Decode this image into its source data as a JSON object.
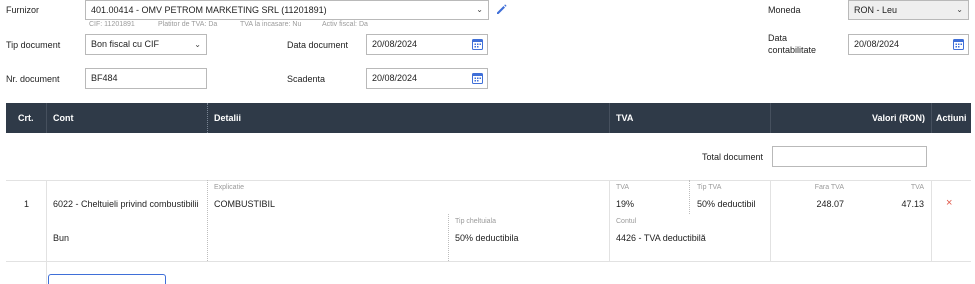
{
  "header": {
    "furnizor_label": "Furnizor",
    "furnizor_value": "401.00414 - OMV PETROM MARKETING SRL (11201891)",
    "meta": {
      "cif": "CIF: 11201891",
      "tva_payer": "Platitor de TVA: Da",
      "tva_incasare": "TVA la incasare: Nu",
      "activ_fiscal": "Activ fiscal: Da"
    },
    "moneda_label": "Moneda",
    "moneda_value": "RON - Leu",
    "tip_document_label": "Tip document",
    "tip_document_value": "Bon fiscal cu CIF",
    "data_document_label": "Data document",
    "data_document_value": "20/08/2024",
    "data_contabilitate_label_1": "Data",
    "data_contabilitate_label_2": "contabilitate",
    "data_contabilitate_value": "20/08/2024",
    "nr_document_label": "Nr. document",
    "nr_document_value": "BF484",
    "scadenta_label": "Scadenta",
    "scadenta_value": "20/08/2024"
  },
  "table": {
    "columns": {
      "crt": "Crt.",
      "cont": "Cont",
      "detalii": "Detalii",
      "tva": "TVA",
      "valori": "Valori (RON)",
      "actiuni": "Actiuni"
    },
    "total_label": "Total document",
    "total_value": "",
    "rows": [
      {
        "crt": "1",
        "cont": "6022 - Cheltuieli privind combustibilii",
        "explicatie_label": "Explicatie",
        "explicatie": "COMBUSTIBIL",
        "tva_label": "TVA",
        "tva": "19%",
        "tip_tva_label": "Tip TVA",
        "tip_tva": "50% deductibil",
        "fara_tva_label": "Fara TVA",
        "fara_tva": "248.07",
        "tva_value_label": "TVA",
        "tva_value": "47.13",
        "bun": "Bun",
        "tip_cheltuiala_label": "Tip cheltuiala",
        "tip_cheltuiala": "50% deductibila",
        "contul_label": "Contul",
        "contul": "4426 - TVA deductibilă"
      }
    ]
  },
  "colors": {
    "header_bg": "#2f3a48",
    "accent": "#3f6fd8",
    "delete": "#e0584a"
  },
  "icons": {
    "edit": "pencil-icon",
    "calendar": "calendar-icon",
    "delete": "close-icon"
  }
}
